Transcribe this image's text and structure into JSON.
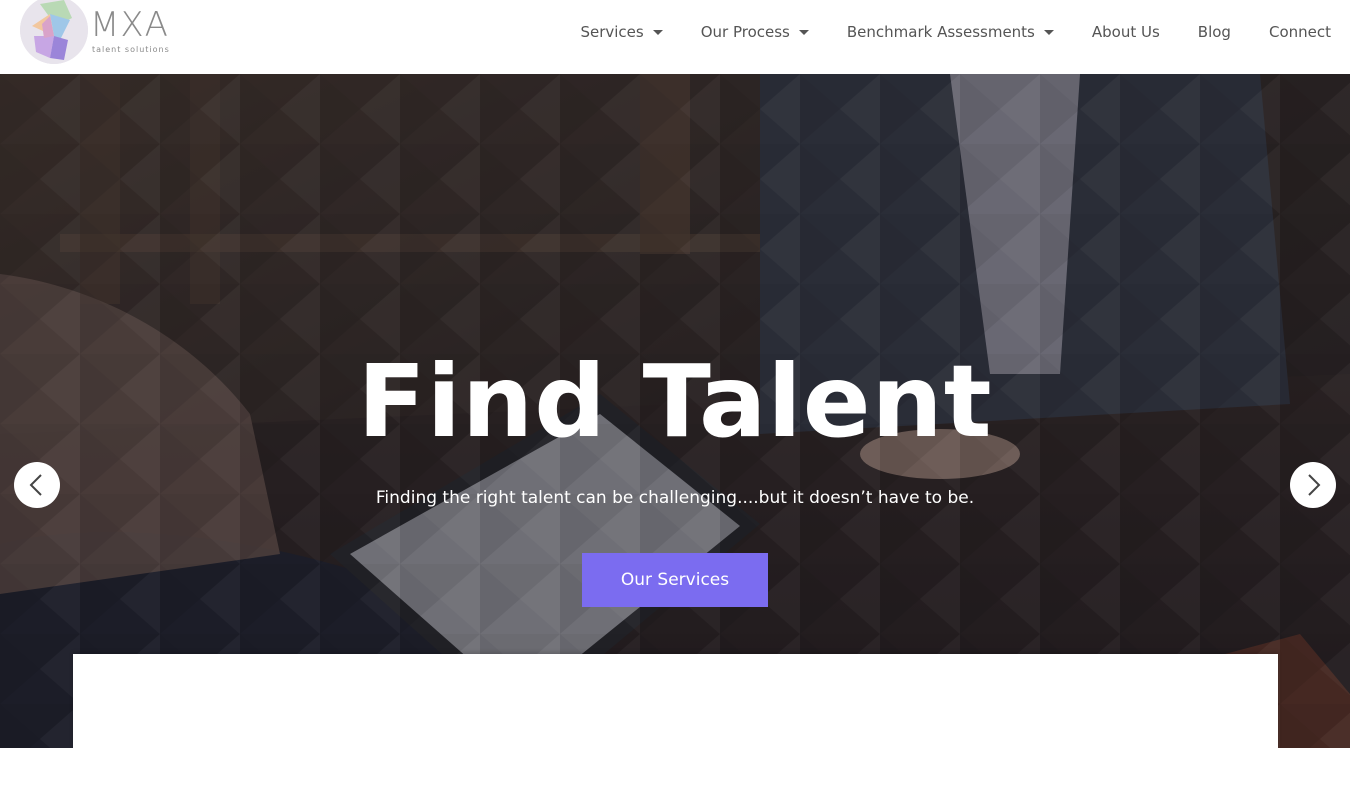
{
  "brand": {
    "name": "MXA",
    "tagline": "talent solutions"
  },
  "nav": {
    "items": [
      {
        "label": "Services",
        "dropdown": true
      },
      {
        "label": "Our Process",
        "dropdown": true
      },
      {
        "label": "Benchmark Assessments",
        "dropdown": true
      },
      {
        "label": "About Us",
        "dropdown": false
      },
      {
        "label": "Blog",
        "dropdown": false
      },
      {
        "label": "Connect",
        "dropdown": false
      }
    ]
  },
  "hero": {
    "title": "Find Talent",
    "subtitle": "Finding the right talent can be challenging....but it doesn’t have to be.",
    "cta_label": "Our Services",
    "prev_icon": "chevron-left-icon",
    "next_icon": "chevron-right-icon"
  },
  "colors": {
    "accent": "#7b6cf0",
    "nav_text": "#555555",
    "logo_text": "#8a8a8a"
  }
}
